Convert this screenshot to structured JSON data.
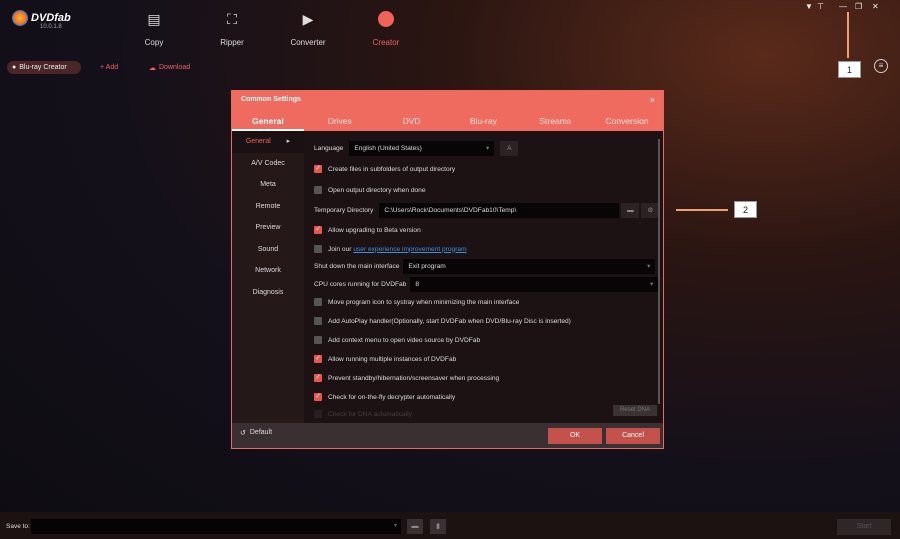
{
  "app": {
    "name": "DVDfab",
    "version": "10.0.1.8"
  },
  "nav": [
    {
      "label": "Copy",
      "icon": "copy-icon"
    },
    {
      "label": "Ripper",
      "icon": "ripper-icon"
    },
    {
      "label": "Converter",
      "icon": "converter-icon"
    },
    {
      "label": "Creator",
      "icon": "creator-icon",
      "active": true
    }
  ],
  "subbar": {
    "mode": "Blu-ray Creator",
    "add": "+ Add",
    "download": "Download"
  },
  "callouts": [
    "1",
    "2"
  ],
  "dialog": {
    "title": "Common Settings",
    "close": "×",
    "tabs": [
      "General",
      "Drives",
      "DVD",
      "Blu-ray",
      "Streams",
      "Conversion"
    ],
    "sidebar": [
      "General",
      "A/V Codec",
      "Meta",
      "Remote",
      "Preview",
      "Sound",
      "Network",
      "Diagnosis"
    ],
    "language": {
      "label": "Language",
      "value": "English (United States)",
      "font_btn": "A"
    },
    "opt_subfolders": "Create files in subfolders of output directory",
    "opt_open_dir": "Open output directory when done",
    "temp_dir": {
      "label": "Temporary Directory",
      "value": "C:\\Users\\Rock\\Documents\\DVDFab10\\Temp\\"
    },
    "opt_beta": "Allow upgrading to Beta version",
    "opt_join": {
      "prefix": "Join our",
      "link": "user experience improvement program"
    },
    "shutdown": {
      "label": "Shut down the main interface",
      "value": "Exit program"
    },
    "cpu": {
      "label": "CPU cores running for DVDFab",
      "value": "8"
    },
    "opt_systray": "Move program icon to systray when minimizing the main interface",
    "opt_autoplay": "Add AutoPlay handler(Optionally, start DVDFab when DVD/Blu-ray Disc is inserted)",
    "opt_context": "Add context menu to open video source by DVDFab",
    "opt_multi": "Allow running multiple instances of DVDFab",
    "opt_standby": "Prevent standby/hibernation/screensaver when processing",
    "opt_decrypter": "Check for on-the-fly decrypter automatically",
    "opt_dna": "Check for DNA automatically",
    "reset_dna": "Reset DNA",
    "default": "Default",
    "ok": "OK",
    "cancel": "Cancel"
  },
  "footer": {
    "save_to": "Save to:",
    "start": "Start"
  }
}
